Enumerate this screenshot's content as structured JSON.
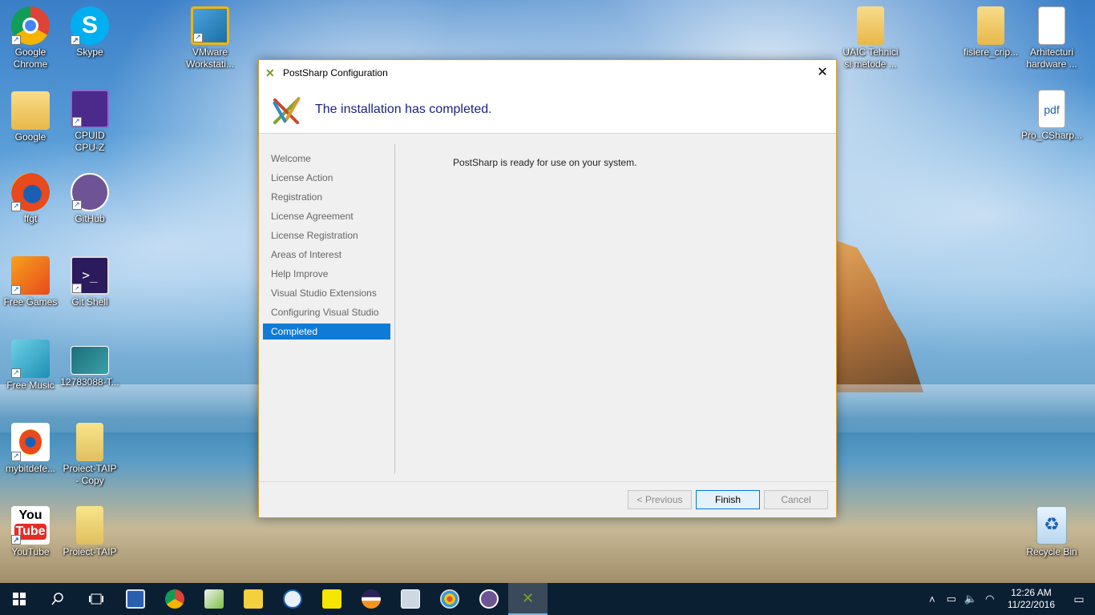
{
  "desktop": {
    "icons_left": [
      {
        "label": "Google\nChrome",
        "icon": "chrome-icon"
      },
      {
        "label": "Skype",
        "icon": "skype-icon"
      },
      {
        "label": "VMware\nWorkstati...",
        "icon": "vmware-icon"
      },
      {
        "label": "Google",
        "icon": "folder-icon"
      },
      {
        "label": "CPUID\nCPU-Z",
        "icon": "cpuz-icon"
      },
      {
        "label": "ffgt",
        "icon": "firefox-icon"
      },
      {
        "label": "GitHub",
        "icon": "github-icon"
      },
      {
        "label": "Free Games",
        "icon": "free-games-icon"
      },
      {
        "label": "Git Shell",
        "icon": "git-shell-icon"
      },
      {
        "label": "Free Music",
        "icon": "free-music-icon"
      },
      {
        "label": "12783088-T...",
        "icon": "image-icon"
      },
      {
        "label": "mybitdefe...",
        "icon": "bitdefender-icon"
      },
      {
        "label": "Proiect-TAIP\n- Copy",
        "icon": "winrar-icon"
      },
      {
        "label": "YouTube",
        "icon": "youtube-icon"
      },
      {
        "label": "Proiect-TAIP",
        "icon": "winrar-icon"
      }
    ],
    "icons_right": [
      {
        "label": "UAIC Tehnici\nsi metode ...",
        "icon": "folder-icon"
      },
      {
        "label": "fisiere_crip...",
        "icon": "folder-icon"
      },
      {
        "label": "Arhitecturi\nhardware ...",
        "icon": "folder-icon"
      },
      {
        "label": "Pro_CSharp...",
        "icon": "pdf-icon"
      },
      {
        "label": "Recycle Bin",
        "icon": "recycle-bin-icon"
      }
    ]
  },
  "dialog": {
    "title": "PostSharp Configuration",
    "header": "The installation has completed.",
    "steps": [
      "Welcome",
      "License Action",
      "Registration",
      "License Agreement",
      "License Registration",
      "Areas of Interest",
      "Help Improve",
      "Visual Studio Extensions",
      "Configuring Visual Studio",
      "Completed"
    ],
    "active_step": "Completed",
    "message": "PostSharp is ready for use on your system.",
    "buttons": {
      "previous": "< Previous",
      "finish": "Finish",
      "cancel": "Cancel"
    }
  },
  "taskbar": {
    "clock_time": "12:26 AM",
    "clock_date": "11/22/2016",
    "colors": {
      "background": "#0b1f33",
      "accent": "#0f7bd6"
    }
  }
}
